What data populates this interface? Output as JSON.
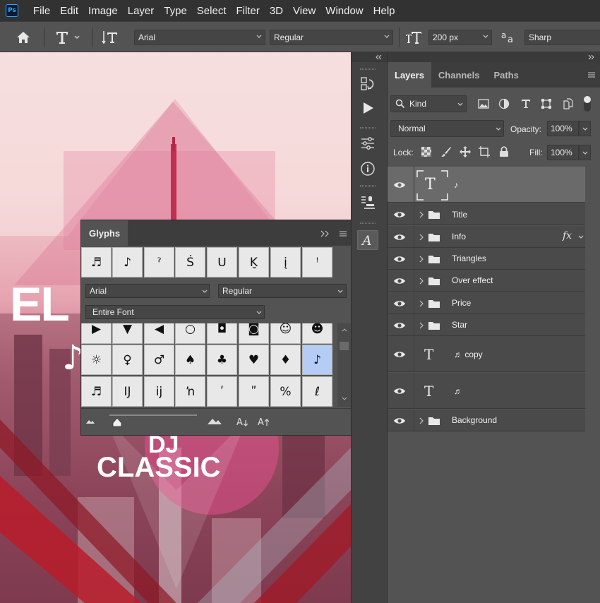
{
  "menu": {
    "logo": "Ps",
    "items": [
      "File",
      "Edit",
      "Image",
      "Layer",
      "Type",
      "Select",
      "Filter",
      "3D",
      "View",
      "Window",
      "Help"
    ]
  },
  "options_bar": {
    "font_family": "Arial",
    "font_style": "Regular",
    "font_size": "200 px",
    "antialias": "Sharp",
    "icons": [
      "home-icon",
      "type-tool-icon",
      "text-orientation-icon",
      "font-size-icon",
      "antialias-icon"
    ]
  },
  "canvas": {
    "title_text": "EL",
    "note_glyph": "♪",
    "dj_text": "DJ",
    "classic_text": "CLASSIC"
  },
  "layers_panel": {
    "tabs": [
      "Layers",
      "Channels",
      "Paths"
    ],
    "active_tab": "Layers",
    "filter_kind": "Kind",
    "blend_mode": "Normal",
    "opacity_label": "Opacity:",
    "opacity_value": "100%",
    "lock_label": "Lock:",
    "fill_label": "Fill:",
    "fill_value": "100%",
    "layers": [
      {
        "name": "♪",
        "type": "text",
        "selected": true
      },
      {
        "name": "Title",
        "type": "group"
      },
      {
        "name": "Info",
        "type": "group",
        "fx": "fx"
      },
      {
        "name": "Triangles",
        "type": "group"
      },
      {
        "name": "Over effect",
        "type": "group"
      },
      {
        "name": "Price",
        "type": "group"
      },
      {
        "name": "Star",
        "type": "group"
      },
      {
        "name": "♬ copy",
        "type": "text"
      },
      {
        "name": "♬",
        "type": "text"
      },
      {
        "name": "Background",
        "type": "group"
      }
    ]
  },
  "glyphs_panel": {
    "title": "Glyphs",
    "recent": [
      "♬",
      "♪",
      "ˀ",
      "Ṡ",
      "ᑌ",
      "Ḵ",
      "į",
      "ꜝ"
    ],
    "font_family": "Arial",
    "font_style": "Regular",
    "subset": "Entire Font",
    "grid": [
      [
        "▶",
        "▼",
        "◀",
        "○",
        "◘",
        "◙",
        "☺",
        "☻"
      ],
      [
        "☼",
        "♀",
        "♂",
        "♠",
        "♣",
        "♥",
        "♦",
        "♪"
      ],
      [
        "♬",
        "Ĳ",
        "ĳ",
        "ŉ",
        "ʹ",
        "ʺ",
        "%",
        "ℓ"
      ]
    ],
    "selected_glyph": "♪",
    "footer_icons": [
      "small-mountain-icon",
      "size-slider",
      "large-mountain-icon",
      "decrease-size-icon",
      "increase-size-icon"
    ]
  }
}
